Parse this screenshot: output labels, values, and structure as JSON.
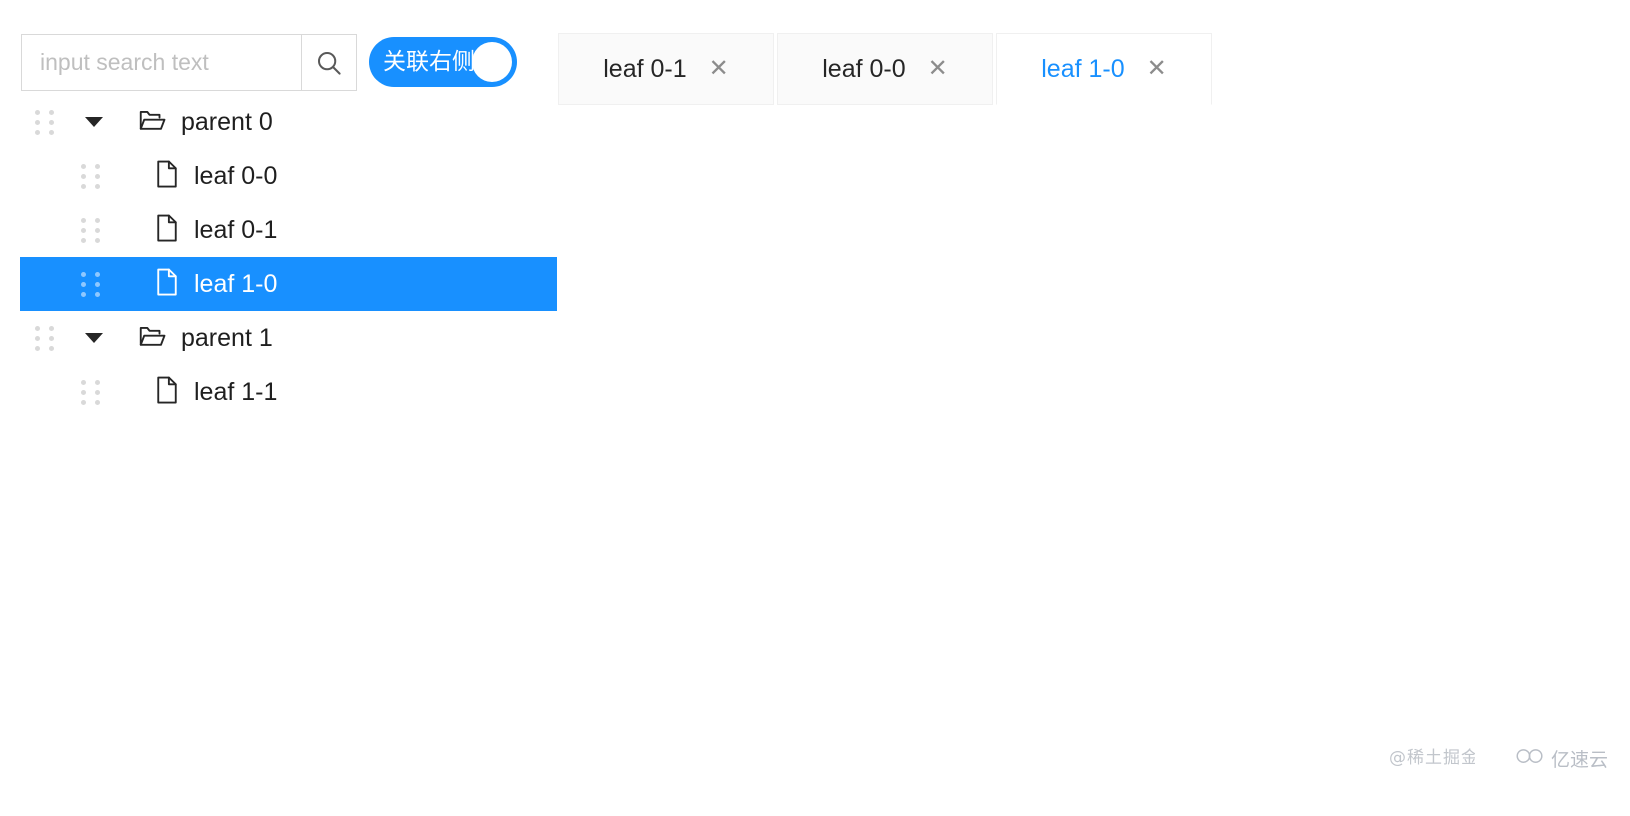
{
  "search": {
    "placeholder": "input search text",
    "value": "",
    "icon": "search-icon"
  },
  "toggle": {
    "label": "关联右侧",
    "checked": true,
    "on_color": "#1890ff",
    "knob_color": "#ffffff"
  },
  "tabs": {
    "items": [
      {
        "label": "leaf 0-1",
        "active": false,
        "close": "✕"
      },
      {
        "label": "leaf 0-0",
        "active": false,
        "close": "✕"
      },
      {
        "label": "leaf 1-0",
        "active": true,
        "close": "✕"
      }
    ],
    "active_color": "#1890ff",
    "inactive_bg": "#fafafa"
  },
  "tree": {
    "selected_bg": "#1890ff",
    "rows": [
      {
        "label": "parent 0",
        "type": "parent",
        "expanded": true,
        "selected": false,
        "icon": "folder-open-icon"
      },
      {
        "label": "leaf 0-0",
        "type": "leaf",
        "expanded": false,
        "selected": false,
        "icon": "file-icon"
      },
      {
        "label": "leaf 0-1",
        "type": "leaf",
        "expanded": false,
        "selected": false,
        "icon": "file-icon"
      },
      {
        "label": "leaf 1-0",
        "type": "leaf",
        "expanded": false,
        "selected": true,
        "icon": "file-icon"
      },
      {
        "label": "parent 1",
        "type": "parent",
        "expanded": true,
        "selected": false,
        "icon": "folder-open-icon"
      },
      {
        "label": "leaf 1-1",
        "type": "leaf",
        "expanded": false,
        "selected": false,
        "icon": "file-icon"
      }
    ]
  },
  "watermarks": {
    "juejin": "@稀土掘金",
    "yisu": "亿速云"
  }
}
